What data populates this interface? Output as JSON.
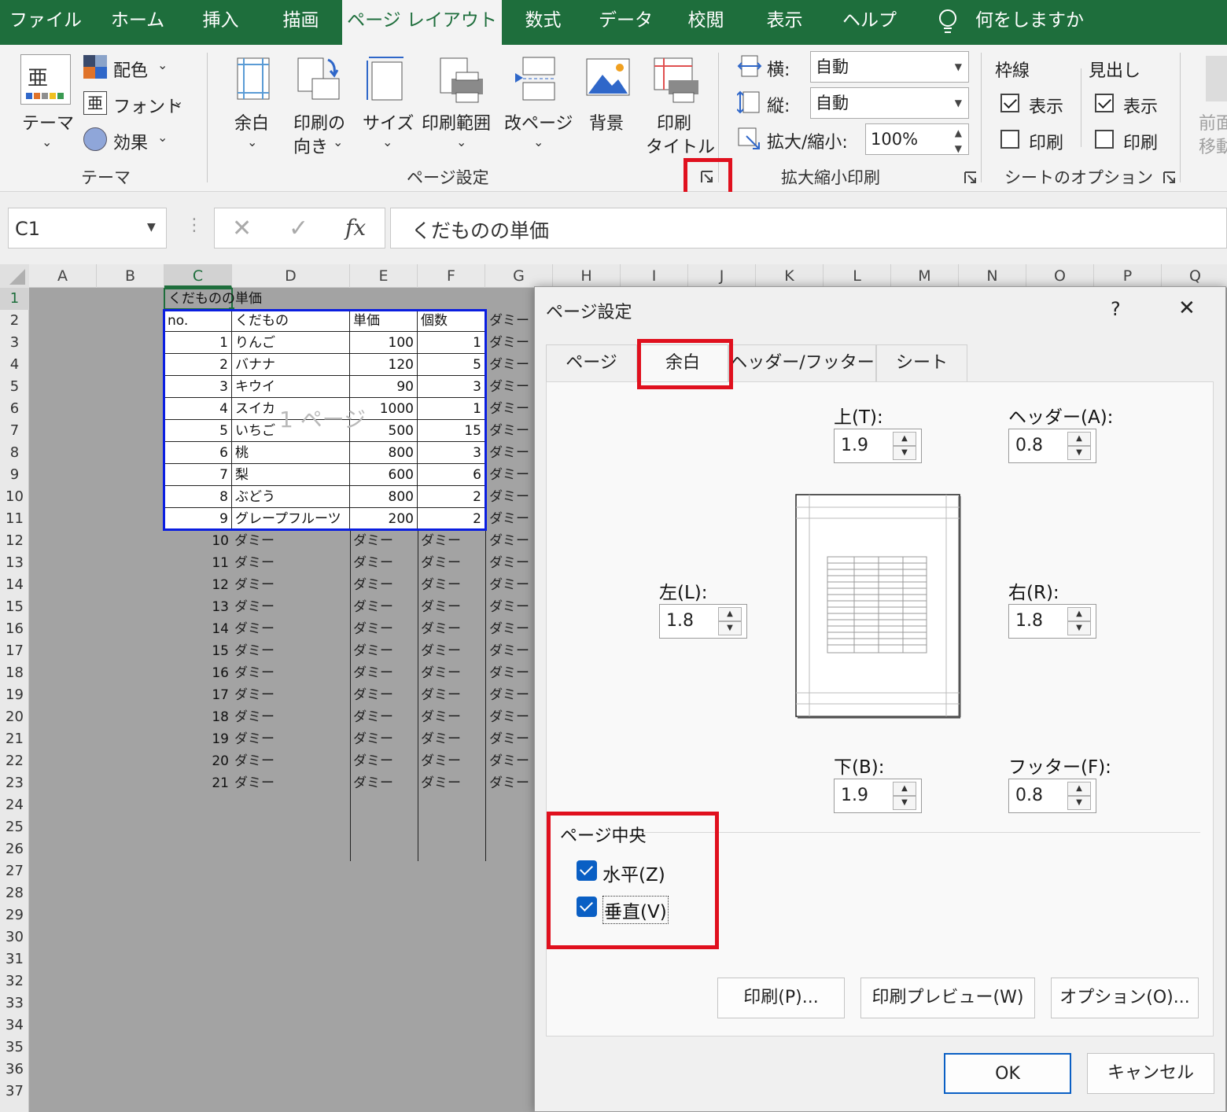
{
  "tabs": [
    "ファイル",
    "ホーム",
    "挿入",
    "描画",
    "ページ レイアウト",
    "数式",
    "データ",
    "校閲",
    "表示",
    "ヘルプ"
  ],
  "tell_me": "何をしますか",
  "ribbon": {
    "theme": {
      "themes": "テーマ",
      "colors": "配色",
      "fonts": "フォント",
      "effects": "効果",
      "group": "テーマ"
    },
    "page_setup": {
      "margins": "余白",
      "orientation_1": "印刷の",
      "orientation_2": "向き",
      "size": "サイズ",
      "print_area": "印刷範囲",
      "breaks": "改ページ",
      "background": "背景",
      "titles_1": "印刷",
      "titles_2": "タイトル",
      "group": "ページ設定"
    },
    "scale": {
      "width_label": "横:",
      "width_value": "自動",
      "height_label": "縦:",
      "height_value": "自動",
      "scale_label": "拡大/縮小:",
      "scale_value": "100%",
      "group": "拡大縮小印刷"
    },
    "sheet_options": {
      "gridlines": "枠線",
      "headings": "見出し",
      "view": "表示",
      "print": "印刷",
      "group": "シートのオプション"
    },
    "arrange": {
      "line1": "前面",
      "line2": "移動"
    }
  },
  "formula_bar": {
    "name_box": "C1",
    "fx": "fx",
    "content": "くだものの単価"
  },
  "columns": [
    "A",
    "B",
    "C",
    "D",
    "E",
    "F",
    "G",
    "H",
    "I",
    "J",
    "K",
    "L",
    "M",
    "N",
    "O",
    "P",
    "Q"
  ],
  "sheet": {
    "title": "くだものの単価",
    "headers": [
      "no.",
      "くだもの",
      "単価",
      "個数"
    ],
    "rows": [
      [
        "1",
        "りんご",
        "100",
        "1"
      ],
      [
        "2",
        "バナナ",
        "120",
        "5"
      ],
      [
        "3",
        "キウイ",
        "90",
        "3"
      ],
      [
        "4",
        "スイカ",
        "1000",
        "1"
      ],
      [
        "5",
        "いちご",
        "500",
        "15"
      ],
      [
        "6",
        "桃",
        "800",
        "3"
      ],
      [
        "7",
        "梨",
        "600",
        "6"
      ],
      [
        "8",
        "ぶどう",
        "800",
        "2"
      ],
      [
        "9",
        "グレープフルーツ",
        "200",
        "2"
      ]
    ],
    "dummy": "ダミー",
    "dummy_numbers": [
      "10",
      "11",
      "12",
      "13",
      "14",
      "15",
      "16",
      "17",
      "18",
      "19",
      "20",
      "21"
    ],
    "page_watermark": "1 ページ"
  },
  "dialog": {
    "title": "ページ設定",
    "help": "?",
    "close": "✕",
    "tabs": [
      "ページ",
      "余白",
      "ヘッダー/フッター",
      "シート"
    ],
    "top_label": "上(T):",
    "top_value": "1.9",
    "header_label": "ヘッダー(A):",
    "header_value": "0.8",
    "left_label": "左(L):",
    "left_value": "1.8",
    "right_label": "右(R):",
    "right_value": "1.8",
    "bottom_label": "下(B):",
    "bottom_value": "1.9",
    "footer_label": "フッター(F):",
    "footer_value": "0.8",
    "center_section": "ページ中央",
    "horizontal": "水平(Z)",
    "vertical": "垂直(V)",
    "print_btn": "印刷(P)...",
    "preview_btn": "印刷プレビュー(W)",
    "options_btn": "オプション(O)...",
    "ok": "OK",
    "cancel": "キャンセル"
  },
  "colors": {
    "ribbon_green": "#1e6e3c",
    "highlight_red": "#e0101e",
    "table_border_blue": "#0a1ee0",
    "check_blue": "#0a5fc4"
  }
}
